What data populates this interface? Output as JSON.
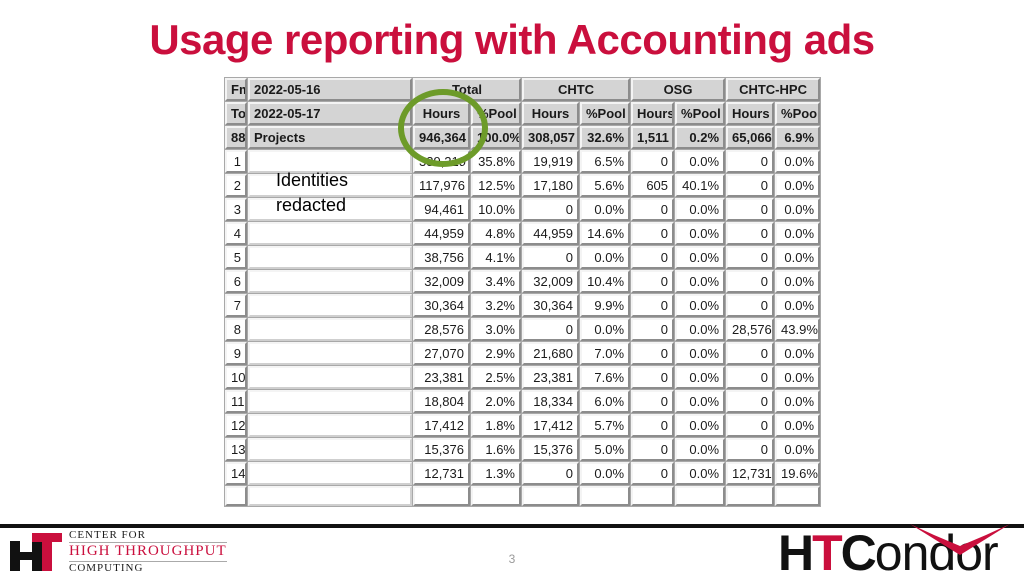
{
  "slide": {
    "title": "Usage reporting with Accounting ads",
    "page_number": "3",
    "title_color": "#ca0f3d",
    "highlight_color": "#6d9b29"
  },
  "annotation": {
    "redacted_note_line1": "Identities",
    "redacted_note_line2": "redacted",
    "highlight_target": "Total Hours 946,364"
  },
  "table": {
    "meta": {
      "from_label": "Fm:",
      "from_date": "2022-05-16",
      "to_label": "To:",
      "to_date": "2022-05-17",
      "project_count": "88",
      "project_label": "Projects"
    },
    "group_headers": [
      "Total",
      "CHTC",
      "OSG",
      "CHTC-HPC"
    ],
    "sub_headers": [
      "Hours",
      "%Pool",
      "Hours",
      "%Pool",
      "Hours",
      "%Pool",
      "Hours",
      "%Pool"
    ],
    "totals": [
      "946,364",
      "100.0%",
      "308,057",
      "32.6%",
      "1,511",
      "0.2%",
      "65,066",
      "6.9%"
    ],
    "rows": [
      {
        "index": "1",
        "name": "",
        "cells": [
          "339,219",
          "35.8%",
          "19,919",
          "6.5%",
          "0",
          "0.0%",
          "0",
          "0.0%"
        ]
      },
      {
        "index": "2",
        "name": "",
        "cells": [
          "117,976",
          "12.5%",
          "17,180",
          "5.6%",
          "605",
          "40.1%",
          "0",
          "0.0%"
        ]
      },
      {
        "index": "3",
        "name": "",
        "cells": [
          "94,461",
          "10.0%",
          "0",
          "0.0%",
          "0",
          "0.0%",
          "0",
          "0.0%"
        ]
      },
      {
        "index": "4",
        "name": "",
        "cells": [
          "44,959",
          "4.8%",
          "44,959",
          "14.6%",
          "0",
          "0.0%",
          "0",
          "0.0%"
        ]
      },
      {
        "index": "5",
        "name": "",
        "cells": [
          "38,756",
          "4.1%",
          "0",
          "0.0%",
          "0",
          "0.0%",
          "0",
          "0.0%"
        ]
      },
      {
        "index": "6",
        "name": "",
        "cells": [
          "32,009",
          "3.4%",
          "32,009",
          "10.4%",
          "0",
          "0.0%",
          "0",
          "0.0%"
        ]
      },
      {
        "index": "7",
        "name": "",
        "cells": [
          "30,364",
          "3.2%",
          "30,364",
          "9.9%",
          "0",
          "0.0%",
          "0",
          "0.0%"
        ]
      },
      {
        "index": "8",
        "name": "",
        "cells": [
          "28,576",
          "3.0%",
          "0",
          "0.0%",
          "0",
          "0.0%",
          "28,576",
          "43.9%"
        ]
      },
      {
        "index": "9",
        "name": "",
        "cells": [
          "27,070",
          "2.9%",
          "21,680",
          "7.0%",
          "0",
          "0.0%",
          "0",
          "0.0%"
        ]
      },
      {
        "index": "10",
        "name": "",
        "cells": [
          "23,381",
          "2.5%",
          "23,381",
          "7.6%",
          "0",
          "0.0%",
          "0",
          "0.0%"
        ]
      },
      {
        "index": "11",
        "name": "",
        "cells": [
          "18,804",
          "2.0%",
          "18,334",
          "6.0%",
          "0",
          "0.0%",
          "0",
          "0.0%"
        ]
      },
      {
        "index": "12",
        "name": "",
        "cells": [
          "17,412",
          "1.8%",
          "17,412",
          "5.7%",
          "0",
          "0.0%",
          "0",
          "0.0%"
        ]
      },
      {
        "index": "13",
        "name": "",
        "cells": [
          "15,376",
          "1.6%",
          "15,376",
          "5.0%",
          "0",
          "0.0%",
          "0",
          "0.0%"
        ]
      },
      {
        "index": "14",
        "name": "",
        "cells": [
          "12,731",
          "1.3%",
          "0",
          "0.0%",
          "0",
          "0.0%",
          "12,731",
          "19.6%"
        ]
      }
    ]
  },
  "footer": {
    "chtc_logo": {
      "mark_h": "H",
      "mark_t": "T",
      "line1": "CENTER FOR",
      "line2": "HIGH THROUGHPUT",
      "line3": "COMPUTING"
    },
    "htcondor_logo": {
      "h": "H",
      "t": "T",
      "c": "C",
      "ondor": "ondor"
    }
  }
}
